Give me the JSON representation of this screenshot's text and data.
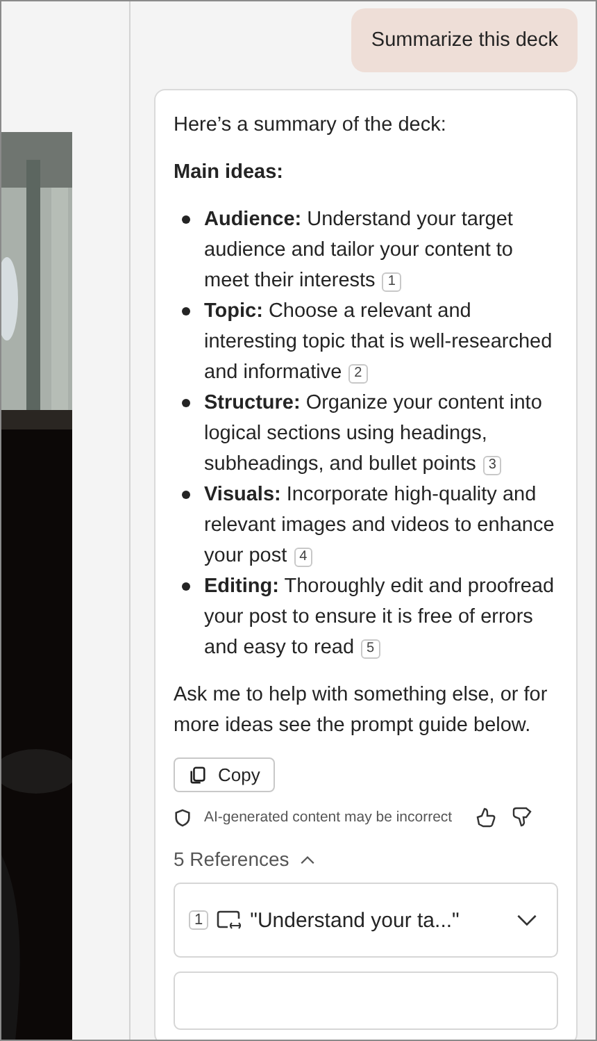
{
  "user_message": "Summarize this deck",
  "response": {
    "intro": "Here’s a summary of the deck:",
    "heading": "Main ideas:",
    "items": [
      {
        "term": "Audience:",
        "text": "Understand your target audience and tailor your content to meet their interests",
        "ref": "1"
      },
      {
        "term": "Topic:",
        "text": "Choose a relevant and interesting topic that is well-researched and informative",
        "ref": "2"
      },
      {
        "term": "Structure:",
        "text": "Organize your content into logical sections using headings, subheadings, and bullet points",
        "ref": "3"
      },
      {
        "term": "Visuals:",
        "text": "Incorporate high-quality and relevant images and videos to enhance your post",
        "ref": "4"
      },
      {
        "term": "Editing:",
        "text": "Thoroughly edit and proofread your post to ensure it is free of errors and easy to read",
        "ref": "5"
      }
    ],
    "outro": "Ask me to help with something else, or for more ideas see the prompt guide below.",
    "copy_button": "Copy",
    "disclaimer": "AI-generated content may be incorrect",
    "references": {
      "label": "5 References",
      "expanded": true,
      "items": [
        {
          "index": "1",
          "text": "\"Understand your ta...\""
        }
      ]
    }
  }
}
